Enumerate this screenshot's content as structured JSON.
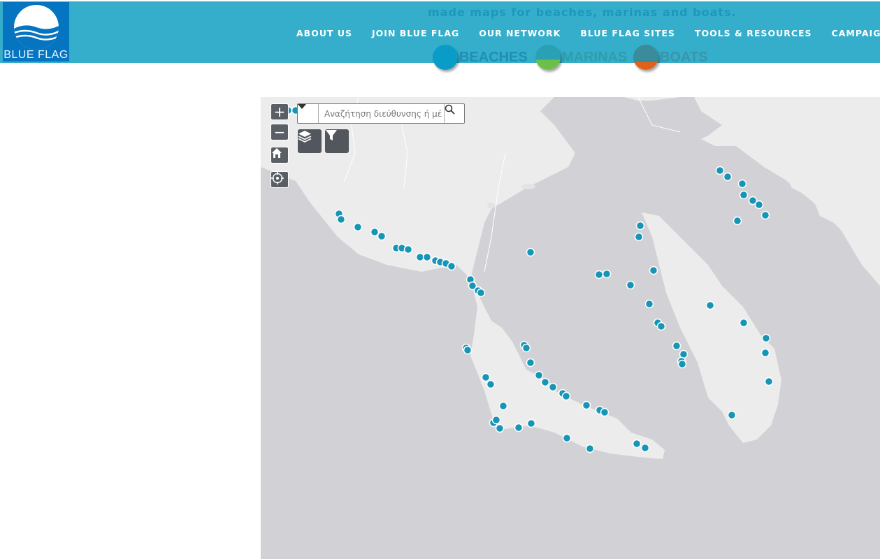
{
  "brand": {
    "logo_text": "BLUE FLAG",
    "color": "#0574c1"
  },
  "header": {
    "tagline": "made maps for beaches, marinas and boats.",
    "nav": [
      "ABOUT US",
      "JOIN BLUE FLAG",
      "OUR NETWORK",
      "BLUE FLAG SITES",
      "TOOLS & RESOURCES",
      "CAMPAIGNS AND"
    ]
  },
  "categories": [
    {
      "label": "BEACHES",
      "color": "#0a9cc9"
    },
    {
      "label": "MARINAS",
      "color": "#3aa65b"
    },
    {
      "label": "BOATS",
      "color": "#e06a1f"
    }
  ],
  "map": {
    "search": {
      "placeholder": "Αναζήτηση διεύθυνσης ή μέ"
    },
    "controls": {
      "zoom_in": "+",
      "zoom_out": "−"
    },
    "marker_color": "#1795b6",
    "icons": [
      "home-icon",
      "locate-icon",
      "layers-icon",
      "filter-icon",
      "search-icon",
      "chevron-down-icon"
    ]
  }
}
